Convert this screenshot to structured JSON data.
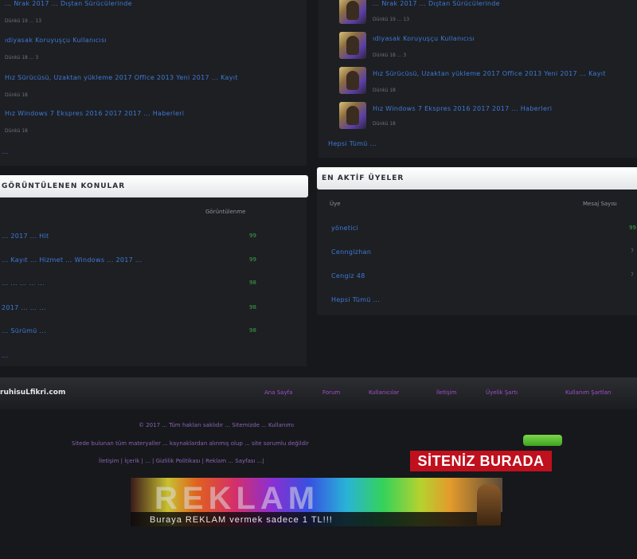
{
  "left_top_list": {
    "items": [
      {
        "title": "... Nrak 2017 ... Dıştan Sürücülerinde",
        "meta": "Dünkü 19 ... 13"
      },
      {
        "title": "ıdiyasak Koruyuşçu Kullanıcısı",
        "meta": "Dünkü 18 ... 3"
      },
      {
        "title": "Hız Sürücüsü, Uzaktan yükleme 2017 Office 2013 Yeni 2017 ... Kayıt",
        "meta": "Dünkü 18"
      },
      {
        "title": "Hız Windows 7 Ekspres 2016 2017 2017 ... Haberleri",
        "meta": "Dünkü 18"
      }
    ],
    "more": "..."
  },
  "right_top_list": {
    "items": [
      {
        "title": "... Nrak 2017 ... Dıştan Sürücülerinde",
        "meta": "Dünkü 19 ... 13"
      },
      {
        "title": "ıdiyasak Koruyuşçu Kullanıcısı",
        "meta": "Dünkü 18 ... 3"
      },
      {
        "title": "Hız Sürücüsü, Uzaktan yükleme 2017 Office 2013 Yeni 2017 ... Kayıt",
        "meta": "Dünkü 18"
      },
      {
        "title": "Hız Windows 7 Ekspres 2016 2017 2017 ... Haberleri",
        "meta": "Dünkü 18"
      }
    ],
    "more": "Hepsi Tümü ..."
  },
  "left_panel": {
    "header": "GÖRÜNTÜLENEN KONULAR",
    "col_header": "Görüntülenme",
    "rows": [
      {
        "title": "... 2017 ... Hit",
        "count": "99"
      },
      {
        "title": "... Kayıt ... Hizmet ... Windows ... 2017 ...",
        "count": "99"
      },
      {
        "title": "... ... ... ... ...",
        "count": "98"
      },
      {
        "title": "2017 ... ... ...",
        "count": "98"
      },
      {
        "title": "... Sürümü ...",
        "count": "98"
      }
    ],
    "more": "..."
  },
  "right_panel": {
    "header": "EN AKTİF ÜYELER",
    "col_name": "Üye",
    "col_count": "Mesaj Sayısı",
    "rows": [
      {
        "name": "yönetici",
        "count": "99"
      },
      {
        "name": "Cenngizhan",
        "count": "7"
      },
      {
        "name": "Cengiz 48",
        "count": "7"
      }
    ],
    "more": "Hepsi Tümü ..."
  },
  "footer": {
    "logo": "ruhisuLfikri.com",
    "links": [
      "Ana Sayfa",
      "Forum",
      "Kullanıcılar",
      "İletişim",
      "Üyelik Şartı",
      "Kullanım Şartları"
    ],
    "copyright": "© 2017 ... Tüm hakları saklıdır ... Sitemizde ... Kullanımı",
    "line2": "Sitede bulunan tüm materyaller ... kaynaklardan alınmış olup ... site sorumlu değildir",
    "line3": "İletişim | İçerik | ... | Gizlilik Politikası | Reklam ... Sayfası ...|",
    "badge": "SİTENİZ BURADA"
  },
  "banner": {
    "word": "REKLAM",
    "sub": "Buraya REKLAM vermek sadece 1 TL!!!"
  }
}
